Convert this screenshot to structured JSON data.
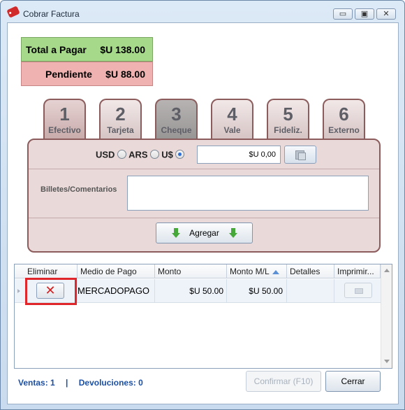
{
  "window": {
    "title": "Cobrar Factura",
    "minimize_glyph": "▭",
    "maximize_glyph": "▣",
    "close_glyph": "✕"
  },
  "summary": {
    "total_label": "Total a Pagar",
    "total_value": "$U 138.00",
    "pending_label": "Pendiente",
    "pending_value": "$U 88.00"
  },
  "tabs": [
    {
      "num": "1",
      "label": "Efectivo",
      "state": "active"
    },
    {
      "num": "2",
      "label": "Tarjeta",
      "state": "normal"
    },
    {
      "num": "3",
      "label": "Cheque",
      "state": "disabled"
    },
    {
      "num": "4",
      "label": "Vale",
      "state": "normal"
    },
    {
      "num": "5",
      "label": "Fideliz.",
      "state": "normal"
    },
    {
      "num": "6",
      "label": "Externo",
      "state": "normal"
    }
  ],
  "payment_panel": {
    "currencies": [
      {
        "label": "USD",
        "checked": false
      },
      {
        "label": "ARS",
        "checked": false
      },
      {
        "label": "U$",
        "checked": true
      }
    ],
    "amount_value": "$U 0,00",
    "comments_label": "Billetes/Comentarios",
    "comments_value": "",
    "add_button_label": "Agregar"
  },
  "grid": {
    "columns": [
      "Eliminar",
      "Medio de Pago",
      "Monto",
      "Monto M/L",
      "Detalles",
      "Imprimir..."
    ],
    "sorted_column": "Monto M/L",
    "rows": [
      {
        "eliminar": "✕",
        "medio": "MERCADOPAGO",
        "monto": "$U 50.00",
        "monto_ml": "$U 50.00",
        "detalles": ""
      }
    ]
  },
  "footer": {
    "ventas": "Ventas: 1",
    "separator": "|",
    "devoluciones": "Devoluciones: 0",
    "confirm_label": "Confirmar (F10)",
    "close_label": "Cerrar"
  },
  "colors": {
    "total_bg": "#a6d98a",
    "pending_bg": "#f0b1b1",
    "tab_border": "#8c5c5c",
    "highlight": "#e0262a",
    "link_blue": "#1b4fa3"
  }
}
